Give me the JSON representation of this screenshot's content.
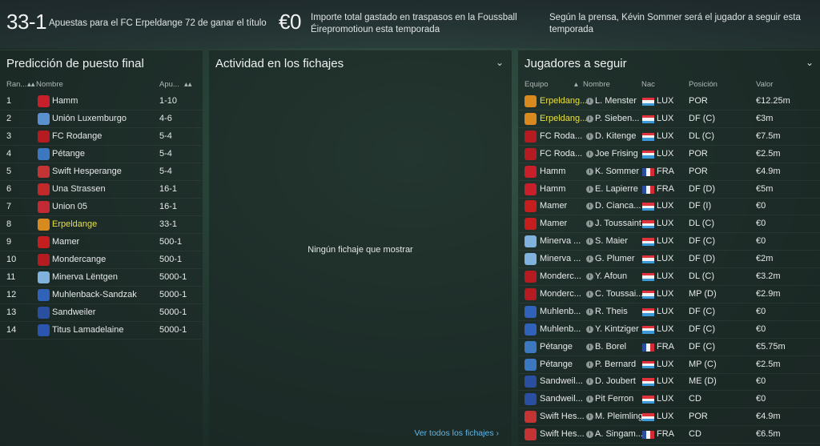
{
  "stats": [
    {
      "big": "33-1",
      "desc_lines": [
        "Apuestas para el FC Erpeldange 72 de ganar el título"
      ]
    },
    {
      "big": "€0",
      "desc_lines": [
        "Importe total gastado en traspasos en la Foussball",
        "Éirepromotioun esta temporada"
      ]
    },
    {
      "big": "",
      "desc_lines": [
        "Según la prensa, Kévin Sommer será el jugador a seguir esta",
        "temporada"
      ]
    }
  ],
  "prediction": {
    "title": "Predicción de puesto final",
    "headers": {
      "rank": "Ran...",
      "name": "Nombre",
      "odds": "Apu..."
    },
    "rows": [
      {
        "rank": "1",
        "name": "Hamm",
        "odds": "1-10",
        "crest": "#c8202a",
        "highlight": false
      },
      {
        "rank": "2",
        "name": "Unión Luxemburgo",
        "odds": "4-6",
        "crest": "#5a8fd0",
        "highlight": false
      },
      {
        "rank": "3",
        "name": "FC Rodange",
        "odds": "5-4",
        "crest": "#b51c22",
        "highlight": false
      },
      {
        "rank": "4",
        "name": "Pétange",
        "odds": "5-4",
        "crest": "#3c78c0",
        "highlight": false
      },
      {
        "rank": "5",
        "name": "Swift Hesperange",
        "odds": "5-4",
        "crest": "#c43434",
        "highlight": false
      },
      {
        "rank": "6",
        "name": "Una Strassen",
        "odds": "16-1",
        "crest": "#c02a2a",
        "highlight": false
      },
      {
        "rank": "7",
        "name": "Union 05",
        "odds": "16-1",
        "crest": "#c22a34",
        "highlight": false
      },
      {
        "rank": "8",
        "name": "Erpeldange",
        "odds": "33-1",
        "crest": "#d98a1e",
        "highlight": true
      },
      {
        "rank": "9",
        "name": "Mamer",
        "odds": "500-1",
        "crest": "#c41e1e",
        "highlight": false
      },
      {
        "rank": "10",
        "name": "Mondercange",
        "odds": "500-1",
        "crest": "#b51c22",
        "highlight": false
      },
      {
        "rank": "11",
        "name": "Minerva Lëntgen",
        "odds": "5000-1",
        "crest": "#7fb2dc",
        "highlight": false
      },
      {
        "rank": "12",
        "name": "Muhlenback-Sandzak",
        "odds": "5000-1",
        "crest": "#2f62b8",
        "highlight": false
      },
      {
        "rank": "13",
        "name": "Sandweiler",
        "odds": "5000-1",
        "crest": "#2a4fa0",
        "highlight": false
      },
      {
        "rank": "14",
        "name": "Titus Lamadelaine",
        "odds": "5000-1",
        "crest": "#2a56b0",
        "highlight": false
      }
    ]
  },
  "transfers": {
    "title": "Actividad en los fichajes",
    "empty": "Ningún fichaje que mostrar",
    "link": "Ver todos los fichajes"
  },
  "watch": {
    "title": "Jugadores a seguir",
    "headers": {
      "team": "Equipo",
      "name": "Nombre",
      "nat": "Nac",
      "pos": "Posición",
      "value": "Valor"
    },
    "rows": [
      {
        "team": "Erpeldang...",
        "name": "L. Menster",
        "nat": "LUX",
        "pos": "POR",
        "value": "€12.25m",
        "crest": "#d98a1e",
        "highlight": true
      },
      {
        "team": "Erpeldang...",
        "name": "P. Sieben...",
        "nat": "LUX",
        "pos": "DF (C)",
        "value": "€3m",
        "crest": "#d98a1e",
        "highlight": true
      },
      {
        "team": "FC Roda...",
        "name": "D. Kitenge",
        "nat": "LUX",
        "pos": "DL (C)",
        "value": "€7.5m",
        "crest": "#b51c22",
        "highlight": false
      },
      {
        "team": "FC Roda...",
        "name": "Joe Frising",
        "nat": "LUX",
        "pos": "POR",
        "value": "€2.5m",
        "crest": "#b51c22",
        "highlight": false
      },
      {
        "team": "Hamm",
        "name": "K. Sommer",
        "nat": "FRA",
        "pos": "POR",
        "value": "€4.9m",
        "crest": "#c8202a",
        "highlight": false
      },
      {
        "team": "Hamm",
        "name": "E. Lapierre",
        "nat": "FRA",
        "pos": "DF (D)",
        "value": "€5m",
        "crest": "#c8202a",
        "highlight": false
      },
      {
        "team": "Mamer",
        "name": "D. Cianca...",
        "nat": "LUX",
        "pos": "DF (I)",
        "value": "€0",
        "crest": "#c41e1e",
        "highlight": false
      },
      {
        "team": "Mamer",
        "name": "J. Toussaint",
        "nat": "LUX",
        "pos": "DL (C)",
        "value": "€0",
        "crest": "#c41e1e",
        "highlight": false
      },
      {
        "team": "Minerva ...",
        "name": "S. Maier",
        "nat": "LUX",
        "pos": "DF (C)",
        "value": "€0",
        "crest": "#7fb2dc",
        "highlight": false
      },
      {
        "team": "Minerva ...",
        "name": "G. Plumer",
        "nat": "LUX",
        "pos": "DF (D)",
        "value": "€2m",
        "crest": "#7fb2dc",
        "highlight": false
      },
      {
        "team": "Monderc...",
        "name": "Y. Afoun",
        "nat": "LUX",
        "pos": "DL (C)",
        "value": "€3.2m",
        "crest": "#b51c22",
        "highlight": false
      },
      {
        "team": "Monderc...",
        "name": "C. Toussai...",
        "nat": "LUX",
        "pos": "MP (D)",
        "value": "€2.9m",
        "crest": "#b51c22",
        "highlight": false
      },
      {
        "team": "Muhlenb...",
        "name": "R. Theis",
        "nat": "LUX",
        "pos": "DF (C)",
        "value": "€0",
        "crest": "#2f62b8",
        "highlight": false
      },
      {
        "team": "Muhlenb...",
        "name": "Y. Kintziger",
        "nat": "LUX",
        "pos": "DF (C)",
        "value": "€0",
        "crest": "#2f62b8",
        "highlight": false
      },
      {
        "team": "Pétange",
        "name": "B. Borel",
        "nat": "FRA",
        "pos": "DF (C)",
        "value": "€5.75m",
        "crest": "#3c78c0",
        "highlight": false
      },
      {
        "team": "Pétange",
        "name": "P. Bernard",
        "nat": "LUX",
        "pos": "MP (C)",
        "value": "€2.5m",
        "crest": "#3c78c0",
        "highlight": false
      },
      {
        "team": "Sandweil...",
        "name": "D. Joubert",
        "nat": "LUX",
        "pos": "ME (D)",
        "value": "€0",
        "crest": "#2a4fa0",
        "highlight": false
      },
      {
        "team": "Sandweil...",
        "name": "Pit Ferron",
        "nat": "LUX",
        "pos": "CD",
        "value": "€0",
        "crest": "#2a4fa0",
        "highlight": false
      },
      {
        "team": "Swift Hes...",
        "name": "M. Pleimling",
        "nat": "LUX",
        "pos": "POR",
        "value": "€4.9m",
        "crest": "#c43434",
        "highlight": false
      },
      {
        "team": "Swift Hes...",
        "name": "A. Singam...",
        "nat": "FRA",
        "pos": "CD",
        "value": "€6.5m",
        "crest": "#c43434",
        "highlight": false
      }
    ]
  },
  "colors": {
    "accent_link": "#5fb7e8",
    "highlight_text": "#e8e040"
  }
}
